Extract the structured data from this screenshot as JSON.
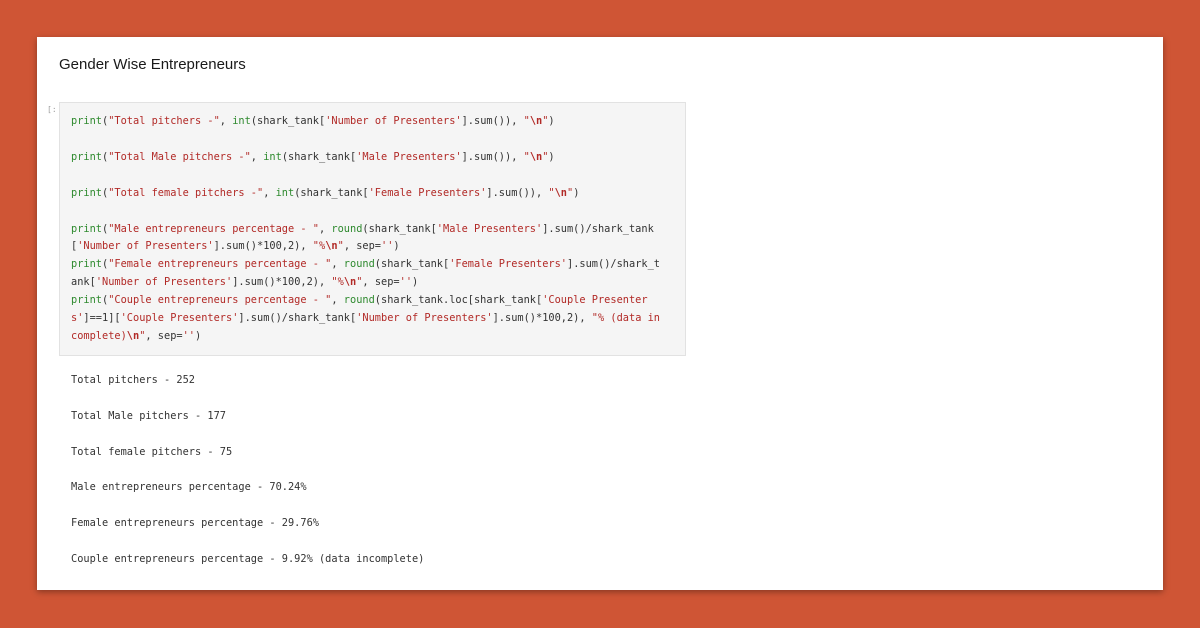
{
  "notebook": {
    "heading": "Gender Wise Entrepreneurs",
    "cell_prompt": "[:",
    "code": {
      "l1": {
        "fn": "print",
        "a": "(",
        "s1": "\"Total pitchers -\"",
        "b": ", ",
        "fn2": "int",
        "c": "(shark_tank[",
        "s2": "'Number of Presenters'",
        "d": "].sum()), ",
        "s3": "\"",
        "e": "\\n",
        "s4": "\"",
        "f": ")"
      },
      "l2": {
        "fn": "print",
        "a": "(",
        "s1": "\"Total Male pitchers -\"",
        "b": ", ",
        "fn2": "int",
        "c": "(shark_tank[",
        "s2": "'Male Presenters'",
        "d": "].sum()), ",
        "s3": "\"",
        "e": "\\n",
        "s4": "\"",
        "f": ")"
      },
      "l3": {
        "fn": "print",
        "a": "(",
        "s1": "\"Total female pitchers -\"",
        "b": ", ",
        "fn2": "int",
        "c": "(shark_tank[",
        "s2": "'Female Presenters'",
        "d": "].sum()), ",
        "s3": "\"",
        "e": "\\n",
        "s4": "\"",
        "f": ")"
      },
      "l4": {
        "fn": "print",
        "a": "(",
        "s1": "\"Male entrepreneurs percentage - \"",
        "b": ", ",
        "fn2": "round",
        "c": "(shark_tank[",
        "s2": "'Male Presenters'",
        "d": "].sum()/shark_tank"
      },
      "l5": {
        "a": "[",
        "s1": "'Number of Presenters'",
        "b": "].sum()*100,2), ",
        "s2": "\"%",
        "e": "\\n",
        "s3": "\"",
        "c": ", sep=",
        "s4": "''",
        "d": ")"
      },
      "l6": {
        "fn": "print",
        "a": "(",
        "s1": "\"Female entrepreneurs percentage - \"",
        "b": ", ",
        "fn2": "round",
        "c": "(shark_tank[",
        "s2": "'Female Presenters'",
        "d": "].sum()/shark_t"
      },
      "l7": {
        "a": "ank[",
        "s1": "'Number of Presenters'",
        "b": "].sum()*100,2), ",
        "s2": "\"%",
        "e": "\\n",
        "s3": "\"",
        "c": ", sep=",
        "s4": "''",
        "d": ")"
      },
      "l8": {
        "fn": "print",
        "a": "(",
        "s1": "\"Couple entrepreneurs percentage - \"",
        "b": ", ",
        "fn2": "round",
        "c": "(shark_tank.loc[shark_tank[",
        "s2": "'Couple Presenter"
      },
      "l9": {
        "s1": "s'",
        "a": "]==1][",
        "s2": "'Couple Presenters'",
        "b": "].sum()/shark_tank[",
        "s3": "'Number of Presenters'",
        "c": "].sum()*100,2), ",
        "s4": "\"% (data in"
      },
      "l10": {
        "s1": "complete)",
        "e": "\\n",
        "s2": "\"",
        "a": ", sep=",
        "s3": "''",
        "b": ")"
      }
    },
    "outputs": [
      "Total pitchers - 252",
      "Total Male pitchers - 177",
      "Total female pitchers - 75",
      "Male entrepreneurs percentage - 70.24%",
      "Female entrepreneurs percentage - 29.76%",
      "Couple entrepreneurs percentage - 9.92% (data incomplete)"
    ]
  }
}
